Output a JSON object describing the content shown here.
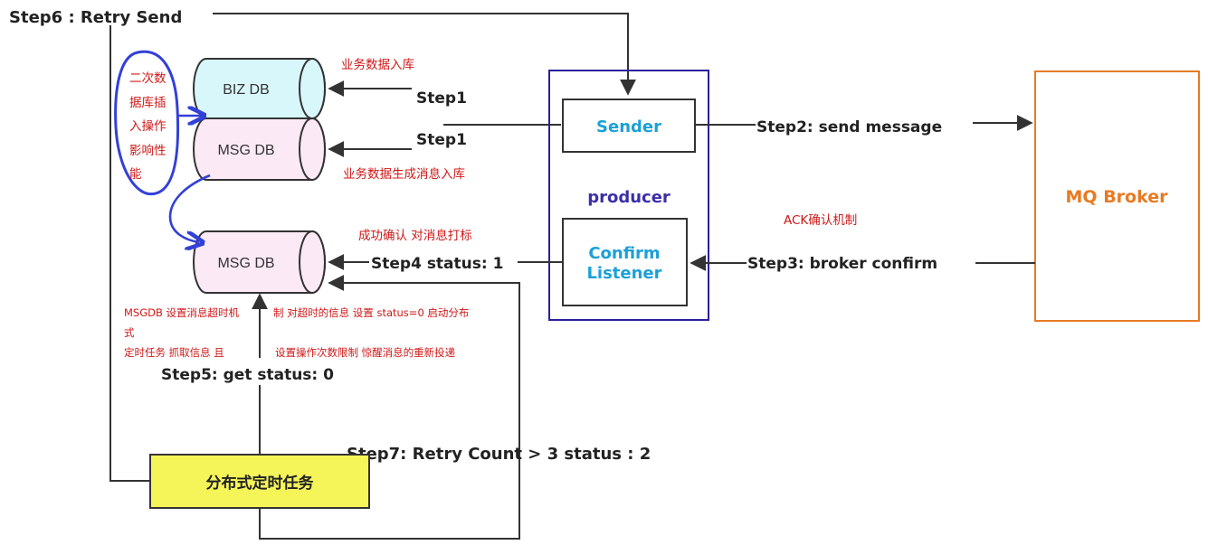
{
  "steps": {
    "step6": "Step6 :  Retry Send",
    "step1_biz": "Step1",
    "step1_msg": "Step1",
    "step2": "Step2:  send message",
    "step3": "Step3:  broker confirm",
    "step4": "Step4  status:  1",
    "step5": "Step5: get status:  0",
    "step7": "Step7: Retry Count  >  3  status : 2"
  },
  "notes": {
    "biz_data_store": "业务数据入库",
    "msg_data_store": "业务数据生成消息入库",
    "confirm_mark": "成功确认 对消息打标",
    "ack_mechanism": "ACK确认机制",
    "msgdb_line1a": "MSGDB 设置消息超时机",
    "msgdb_line1b": "制 对超时的信息 设置 status=0 启动分布",
    "msgdb_line2": "式",
    "msgdb_line3a": "定时任务 抓取信息  且",
    "msgdb_line3b": "设置操作次数限制  惊醒消息的重新投递",
    "handwritten_1": "二次数",
    "handwritten_2": "据库插",
    "handwritten_3": "入操作",
    "handwritten_4": "影响性",
    "handwritten_5": "能"
  },
  "nodes": {
    "biz_db": "BIZ DB",
    "msg_db_top": "MSG DB",
    "msg_db_bottom": "MSG DB",
    "sender": "Sender",
    "producer": "producer",
    "confirm_line1": "Confirm",
    "confirm_line2": "Listener",
    "mq_broker": "MQ Broker",
    "scheduled_task": "分布式定时任务"
  },
  "colors": {
    "biz_db_fill": "#d8f7fa",
    "msg_db_fill": "#fbe9f6",
    "producer_border": "#2a1f9a",
    "mq_border": "#e87a22",
    "task_fill": "#f5f55a",
    "handwriting": "#3340d8",
    "note_red": "#d01818",
    "sender_text": "#1ca0d8"
  }
}
